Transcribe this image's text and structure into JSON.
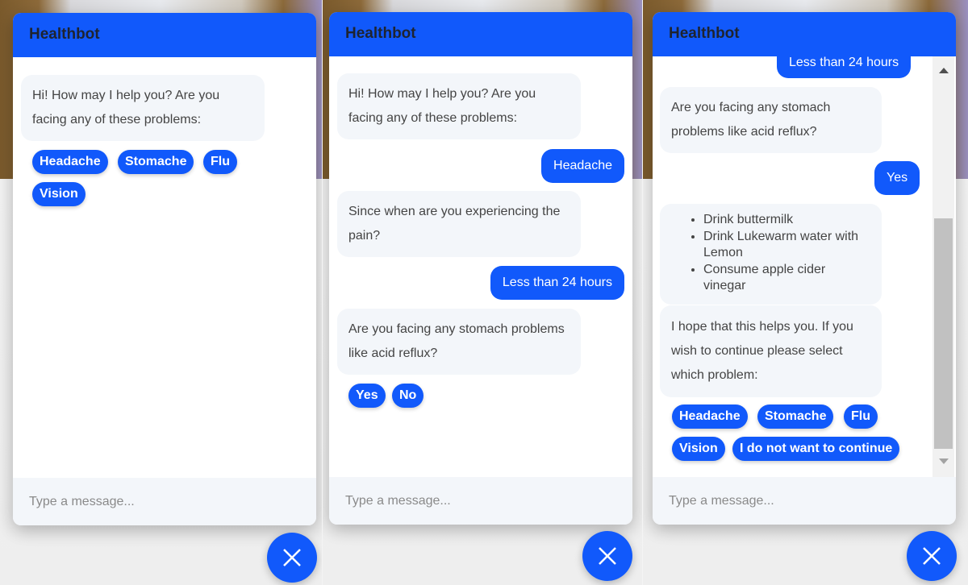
{
  "app_title": "Healthbot",
  "placeholder": "Type a message...",
  "colors": {
    "accent": "#1159fb",
    "bot_bubble": "#f3f6fa"
  },
  "close_icon": "close-icon",
  "panel1": {
    "bot1": "Hi! How may I help you? Are you facing any of these problems:",
    "chips": [
      "Headache",
      "Stomache",
      "Flu",
      "Vision"
    ]
  },
  "panel2": {
    "bot1": "Hi! How may I help you? Are you facing any of these problems:",
    "user1": "Headache",
    "bot2": "Since when are you experiencing the pain?",
    "user2": "Less than 24 hours",
    "bot3": "Are you facing any stomach problems like acid reflux?",
    "chips": [
      "Yes",
      "No"
    ]
  },
  "panel3": {
    "user1": "Less than 24 hours",
    "bot1": "Are you facing any stomach problems like acid reflux?",
    "user2": "Yes",
    "tips": [
      "Drink buttermilk",
      "Drink Lukewarm water with Lemon",
      "Consume apple cider vinegar"
    ],
    "bot2": "I hope that this helps you. If you wish to continue please select which problem:",
    "chips": [
      "Headache",
      "Stomache",
      "Flu",
      "Vision",
      "I do not want to continue"
    ]
  }
}
